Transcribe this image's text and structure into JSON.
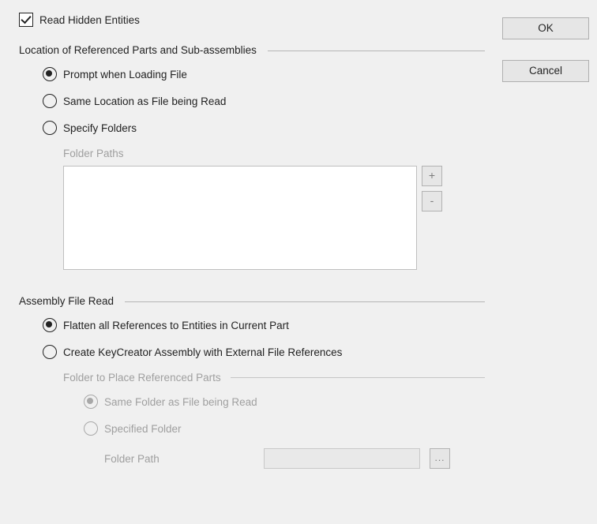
{
  "buttons": {
    "ok": "OK",
    "cancel": "Cancel"
  },
  "checkbox": {
    "read_hidden": {
      "label": "Read Hidden Entities",
      "checked": true
    }
  },
  "group_location": {
    "title": "Location of Referenced Parts and Sub-assemblies",
    "options": {
      "prompt": {
        "label": "Prompt when Loading File",
        "selected": true
      },
      "same": {
        "label": "Same Location as File being Read",
        "selected": false
      },
      "specify": {
        "label": "Specify Folders",
        "selected": false
      }
    },
    "folder_paths_label": "Folder Paths",
    "paths": [],
    "add_btn": "+",
    "remove_btn": "-"
  },
  "group_assembly": {
    "title": "Assembly File Read",
    "options": {
      "flatten": {
        "label": "Flatten all References to Entities in Current Part",
        "selected": true
      },
      "create": {
        "label": "Create KeyCreator Assembly with External File References",
        "selected": false
      }
    },
    "sub_group_title": "Folder to Place Referenced Parts",
    "sub_options": {
      "same_folder": {
        "label": "Same Folder as File being Read",
        "selected": true
      },
      "spec_folder": {
        "label": "Specified Folder",
        "selected": false
      }
    },
    "folder_path_label": "Folder Path",
    "folder_path_value": "",
    "browse": "..."
  }
}
